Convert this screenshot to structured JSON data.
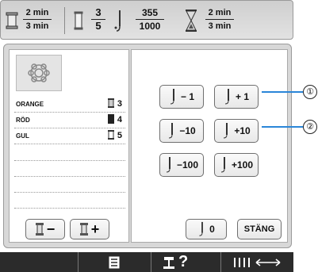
{
  "topbar": {
    "time_current": "2 min",
    "time_total": "3 min",
    "colors_current": "3",
    "colors_total": "5",
    "stitches_current": "355",
    "stitches_total": "1000",
    "remaining_current": "2 min",
    "remaining_total": "3 min"
  },
  "colors": [
    {
      "name": "ORANGE",
      "number": "3"
    },
    {
      "name": "RÖD",
      "number": "4"
    },
    {
      "name": "GUL",
      "number": "5"
    }
  ],
  "needle_buttons": {
    "minus1": "− 1",
    "plus1": "+ 1",
    "minus10": "−10",
    "plus10": "+10",
    "minus100": "−100",
    "plus100": "+100",
    "zero": "0"
  },
  "close_label": "STÄNG",
  "callouts": [
    "①",
    "②"
  ],
  "bottom": {
    "help_label": "?"
  },
  "icons": {
    "spool": "thread-spool-icon",
    "needle": "needle-icon",
    "hourglass": "hourglass-icon"
  }
}
